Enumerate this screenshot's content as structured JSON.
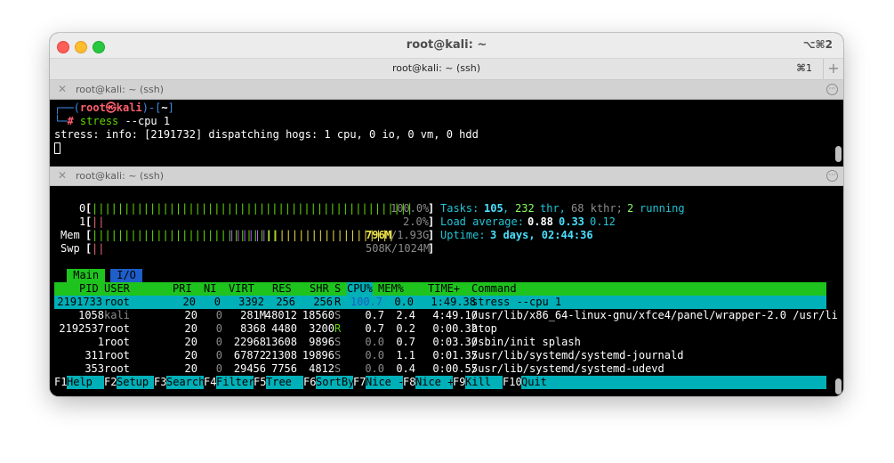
{
  "window": {
    "title": "root@kali: ~",
    "shortcut": "⌥⌘2"
  },
  "tab": {
    "title": "root@kali: ~ (ssh)",
    "shortcut": "⌘1",
    "add_label": "+"
  },
  "pane_top": {
    "title": "root@kali: ~ (ssh)",
    "prompt_left": "┌──(",
    "prompt_user": "root㉿kali",
    "prompt_mid": ")-[",
    "prompt_dir": "~",
    "prompt_right": "]",
    "prompt2": "└─",
    "prompt_hash": "#",
    "command": "stress",
    "command_args": "--cpu 1",
    "output": "stress: info: [2191732] dispatching hogs: 1 cpu, 0 io, 0 vm, 0 hdd"
  },
  "pane_bottom": {
    "title": "root@kali: ~ (ssh)",
    "meters": {
      "cpu0_label": "0",
      "cpu0_bar": "||||||||||||||||||||||||||||||||||||||||||||||||||",
      "cpu0_value": "100.0%",
      "cpu1_label": "1",
      "cpu1_bar": "||",
      "cpu1_value": "2.0%",
      "mem_label": "Mem",
      "mem_bar_green": "|||||||||||||||||||||||||||||",
      "mem_bar_blue": "||||||",
      "mem_bar_yellow": "||||||||||||||||||||",
      "mem_value_used": "796M",
      "mem_value_total": "/1.93G",
      "swp_label": "Swp",
      "swp_bar": "||",
      "swp_value": "508K/1024M"
    },
    "summary": {
      "tasks_label": "Tasks:",
      "tasks": "105",
      "thr": "232",
      "thr_label": "thr,",
      "kthr": "68 kthr;",
      "running": "2",
      "running_label": "running",
      "load_label": "Load average:",
      "load1": "0.88",
      "load5": "0.33",
      "load15": "0.12",
      "uptime_label": "Uptime:",
      "uptime": "3 days, 02:44:36"
    },
    "tabs": [
      "Main",
      "I/O"
    ],
    "columns": [
      "PID",
      "USER",
      "PRI",
      "NI",
      "VIRT",
      "RES",
      "SHR",
      "S",
      "CPU%",
      "MEM%",
      "TIME+",
      "Command"
    ],
    "processes": [
      {
        "pid": "2191733",
        "user": "root",
        "pri": "20",
        "ni": "0",
        "virt": "3392",
        "res": "256",
        "shr": "256",
        "s": "R",
        "cpu": "100.7",
        "mem": "0.0",
        "time": "1:49.38",
        "cmd": "stress --cpu 1"
      },
      {
        "pid": "1058",
        "user": "kali",
        "pri": "20",
        "ni": "0",
        "virt": "281M",
        "res": "48012",
        "shr": "18560",
        "s": "S",
        "cpu": "0.7",
        "mem": "2.4",
        "time": "4:49.10",
        "cmd": "/usr/lib/x86_64-linux-gnu/xfce4/panel/wrapper-2.0 /usr/li"
      },
      {
        "pid": "2192537",
        "user": "root",
        "pri": "20",
        "ni": "0",
        "virt": "8368",
        "res": "4480",
        "shr": "3200",
        "s": "R",
        "cpu": "0.7",
        "mem": "0.2",
        "time": "0:00.32",
        "cmd": "htop"
      },
      {
        "pid": "1",
        "user": "root",
        "pri": "20",
        "ni": "0",
        "virt": "22968",
        "res": "13608",
        "shr": "9896",
        "s": "S",
        "cpu": "0.0",
        "mem": "0.7",
        "time": "0:03.30",
        "cmd": "/sbin/init splash"
      },
      {
        "pid": "311",
        "user": "root",
        "pri": "20",
        "ni": "0",
        "virt": "67872",
        "res": "21308",
        "shr": "19896",
        "s": "S",
        "cpu": "0.0",
        "mem": "1.1",
        "time": "0:01.35",
        "cmd": "/usr/lib/systemd/systemd-journald"
      },
      {
        "pid": "353",
        "user": "root",
        "pri": "20",
        "ni": "0",
        "virt": "29456",
        "res": "7756",
        "shr": "4812",
        "s": "S",
        "cpu": "0.0",
        "mem": "0.4",
        "time": "0:00.55",
        "cmd": "/usr/lib/systemd/systemd-udevd"
      }
    ],
    "function_keys": [
      {
        "key": "F1",
        "label": "Help  "
      },
      {
        "key": "F2",
        "label": "Setup "
      },
      {
        "key": "F3",
        "label": "Search"
      },
      {
        "key": "F4",
        "label": "Filter"
      },
      {
        "key": "F5",
        "label": "Tree  "
      },
      {
        "key": "F6",
        "label": "SortBy"
      },
      {
        "key": "F7",
        "label": "Nice -"
      },
      {
        "key": "F8",
        "label": "Nice +"
      },
      {
        "key": "F9",
        "label": "Kill  "
      },
      {
        "key": "F10",
        "label": "Quit"
      }
    ]
  },
  "colors": {
    "header_bg": "#1ec31e",
    "selected_bg": "#00b0b8",
    "tab_active_bg": "#1ec31e",
    "tab_inactive_bg": "#1e5ec8"
  }
}
